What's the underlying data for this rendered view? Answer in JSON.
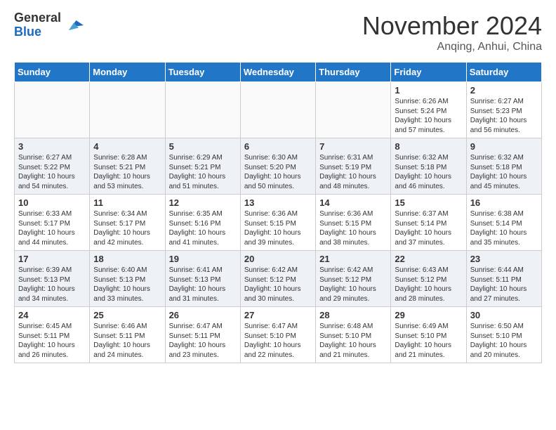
{
  "header": {
    "logo_general": "General",
    "logo_blue": "Blue",
    "month_title": "November 2024",
    "location": "Anqing, Anhui, China"
  },
  "days_of_week": [
    "Sunday",
    "Monday",
    "Tuesday",
    "Wednesday",
    "Thursday",
    "Friday",
    "Saturday"
  ],
  "weeks": [
    [
      {
        "day": "",
        "info": ""
      },
      {
        "day": "",
        "info": ""
      },
      {
        "day": "",
        "info": ""
      },
      {
        "day": "",
        "info": ""
      },
      {
        "day": "",
        "info": ""
      },
      {
        "day": "1",
        "info": "Sunrise: 6:26 AM\nSunset: 5:24 PM\nDaylight: 10 hours and 57 minutes."
      },
      {
        "day": "2",
        "info": "Sunrise: 6:27 AM\nSunset: 5:23 PM\nDaylight: 10 hours and 56 minutes."
      }
    ],
    [
      {
        "day": "3",
        "info": "Sunrise: 6:27 AM\nSunset: 5:22 PM\nDaylight: 10 hours and 54 minutes."
      },
      {
        "day": "4",
        "info": "Sunrise: 6:28 AM\nSunset: 5:21 PM\nDaylight: 10 hours and 53 minutes."
      },
      {
        "day": "5",
        "info": "Sunrise: 6:29 AM\nSunset: 5:21 PM\nDaylight: 10 hours and 51 minutes."
      },
      {
        "day": "6",
        "info": "Sunrise: 6:30 AM\nSunset: 5:20 PM\nDaylight: 10 hours and 50 minutes."
      },
      {
        "day": "7",
        "info": "Sunrise: 6:31 AM\nSunset: 5:19 PM\nDaylight: 10 hours and 48 minutes."
      },
      {
        "day": "8",
        "info": "Sunrise: 6:32 AM\nSunset: 5:18 PM\nDaylight: 10 hours and 46 minutes."
      },
      {
        "day": "9",
        "info": "Sunrise: 6:32 AM\nSunset: 5:18 PM\nDaylight: 10 hours and 45 minutes."
      }
    ],
    [
      {
        "day": "10",
        "info": "Sunrise: 6:33 AM\nSunset: 5:17 PM\nDaylight: 10 hours and 44 minutes."
      },
      {
        "day": "11",
        "info": "Sunrise: 6:34 AM\nSunset: 5:17 PM\nDaylight: 10 hours and 42 minutes."
      },
      {
        "day": "12",
        "info": "Sunrise: 6:35 AM\nSunset: 5:16 PM\nDaylight: 10 hours and 41 minutes."
      },
      {
        "day": "13",
        "info": "Sunrise: 6:36 AM\nSunset: 5:15 PM\nDaylight: 10 hours and 39 minutes."
      },
      {
        "day": "14",
        "info": "Sunrise: 6:36 AM\nSunset: 5:15 PM\nDaylight: 10 hours and 38 minutes."
      },
      {
        "day": "15",
        "info": "Sunrise: 6:37 AM\nSunset: 5:14 PM\nDaylight: 10 hours and 37 minutes."
      },
      {
        "day": "16",
        "info": "Sunrise: 6:38 AM\nSunset: 5:14 PM\nDaylight: 10 hours and 35 minutes."
      }
    ],
    [
      {
        "day": "17",
        "info": "Sunrise: 6:39 AM\nSunset: 5:13 PM\nDaylight: 10 hours and 34 minutes."
      },
      {
        "day": "18",
        "info": "Sunrise: 6:40 AM\nSunset: 5:13 PM\nDaylight: 10 hours and 33 minutes."
      },
      {
        "day": "19",
        "info": "Sunrise: 6:41 AM\nSunset: 5:13 PM\nDaylight: 10 hours and 31 minutes."
      },
      {
        "day": "20",
        "info": "Sunrise: 6:42 AM\nSunset: 5:12 PM\nDaylight: 10 hours and 30 minutes."
      },
      {
        "day": "21",
        "info": "Sunrise: 6:42 AM\nSunset: 5:12 PM\nDaylight: 10 hours and 29 minutes."
      },
      {
        "day": "22",
        "info": "Sunrise: 6:43 AM\nSunset: 5:12 PM\nDaylight: 10 hours and 28 minutes."
      },
      {
        "day": "23",
        "info": "Sunrise: 6:44 AM\nSunset: 5:11 PM\nDaylight: 10 hours and 27 minutes."
      }
    ],
    [
      {
        "day": "24",
        "info": "Sunrise: 6:45 AM\nSunset: 5:11 PM\nDaylight: 10 hours and 26 minutes."
      },
      {
        "day": "25",
        "info": "Sunrise: 6:46 AM\nSunset: 5:11 PM\nDaylight: 10 hours and 24 minutes."
      },
      {
        "day": "26",
        "info": "Sunrise: 6:47 AM\nSunset: 5:11 PM\nDaylight: 10 hours and 23 minutes."
      },
      {
        "day": "27",
        "info": "Sunrise: 6:47 AM\nSunset: 5:10 PM\nDaylight: 10 hours and 22 minutes."
      },
      {
        "day": "28",
        "info": "Sunrise: 6:48 AM\nSunset: 5:10 PM\nDaylight: 10 hours and 21 minutes."
      },
      {
        "day": "29",
        "info": "Sunrise: 6:49 AM\nSunset: 5:10 PM\nDaylight: 10 hours and 21 minutes."
      },
      {
        "day": "30",
        "info": "Sunrise: 6:50 AM\nSunset: 5:10 PM\nDaylight: 10 hours and 20 minutes."
      }
    ]
  ]
}
